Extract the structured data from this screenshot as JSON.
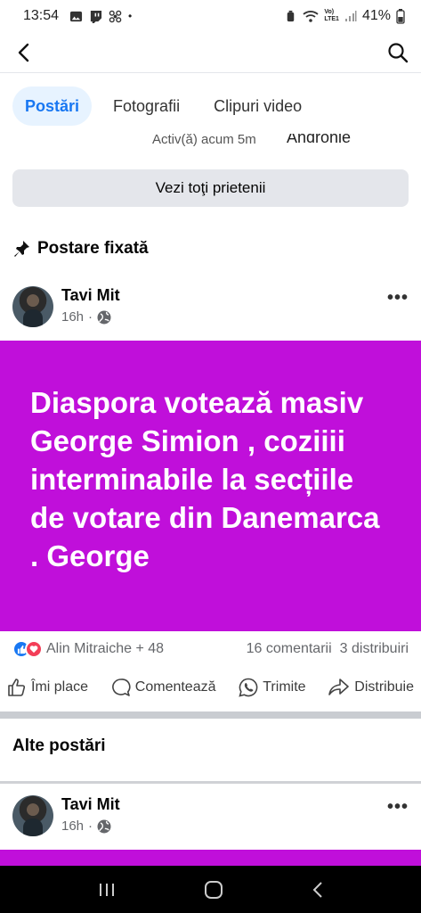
{
  "status": {
    "time": "13:54",
    "carrier_top": "Vo)",
    "carrier_bottom": "LTE1",
    "battery": "41%"
  },
  "tabs": [
    {
      "label": "Postări",
      "active": true
    },
    {
      "label": "Fotografii",
      "active": false
    },
    {
      "label": "Clipuri video",
      "active": false
    }
  ],
  "friends_peek": {
    "left": "Activ(ă) acum 5m",
    "right": "Andronie"
  },
  "see_friends_label": "Vezi toţi prietenii",
  "pinned_label": "Postare fixată",
  "post1": {
    "author": "Tavi Mit",
    "time": "16h",
    "text": "Diaspora votează masiv George Simion , coziiii interminabile la secțiile de votare din Danemarca . George",
    "reactors": "Alin Mitraiche + 48",
    "comments": "16 comentarii",
    "shares": "3 distribuiri"
  },
  "actions": {
    "like": "Îmi place",
    "comment": "Comentează",
    "send": "Trimite",
    "share": "Distribuie"
  },
  "other_posts_label": "Alte postări",
  "post2": {
    "author": "Tavi Mit",
    "time": "16h"
  },
  "colors": {
    "accent": "#1877f2",
    "post_background": "#c00fda",
    "like_reaction": "#1877f2",
    "love_reaction": "#f33e58"
  }
}
